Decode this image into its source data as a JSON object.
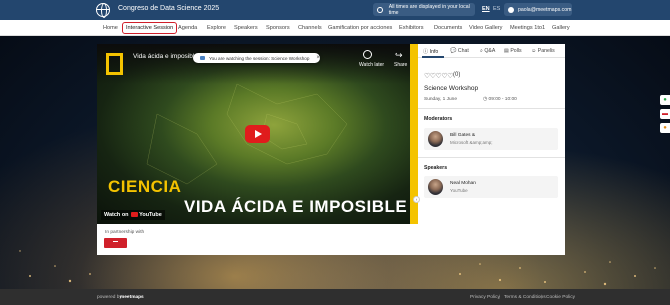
{
  "header": {
    "app_title": "Congreso de Data Science 2025",
    "timezone_notice": "All times are displayed in your local time",
    "languages": [
      "EN",
      "ES"
    ],
    "active_language": "EN",
    "user_email": "paola@meetmaps.com"
  },
  "nav": {
    "items": [
      "Home",
      "Interactive Session",
      "Agenda",
      "Explore",
      "Speakers",
      "Sponsors",
      "Channels",
      "Gamification por acciones",
      "Exhibitors",
      "Documents",
      "Video Gallery",
      "Meetings 1to1",
      "Gallery"
    ],
    "active": "Interactive Session"
  },
  "video": {
    "title": "Vida ácida e imposible | N...",
    "watch_later": "Watch later",
    "share": "Share",
    "overlay_line1": "CIENCIA",
    "overlay_line2": "VIDA ÁCIDA E IMPOSIBLE",
    "watch_on": "Watch on",
    "youtube": "YouTube"
  },
  "toast": {
    "text": "You are watching the session:",
    "session": "Science Workshop",
    "close": "×"
  },
  "partner": {
    "label": "In partnership with"
  },
  "panel": {
    "tabs": [
      "Info",
      "Chat",
      "Q&A",
      "Polls",
      "Panelis"
    ],
    "active_tab": "Info",
    "rating_stars": "♡♡♡♡♡",
    "rating_count": "(0)",
    "session_title": "Science Workshop",
    "session_date": "Sunday, 1 June",
    "session_time": "09:00 - 10:00",
    "moderators_heading": "Moderators",
    "moderator": {
      "name": "Bill Gates &",
      "org": "Microsoft &amp;amp;"
    },
    "speakers_heading": "Speakers",
    "speaker": {
      "name": "Neal Mohan",
      "org": "YouTube"
    }
  },
  "footer": {
    "powered_by": "powered by",
    "brand": "meetmaps",
    "links": [
      "Privacy Policy",
      "Terms & Conditions",
      "Cookie Policy"
    ]
  },
  "colors": {
    "header_bg": "#23466e",
    "active_nav_border": "#d01f2a",
    "accent_yellow": "#f4c300",
    "youtube_red": "#e01c1c"
  }
}
